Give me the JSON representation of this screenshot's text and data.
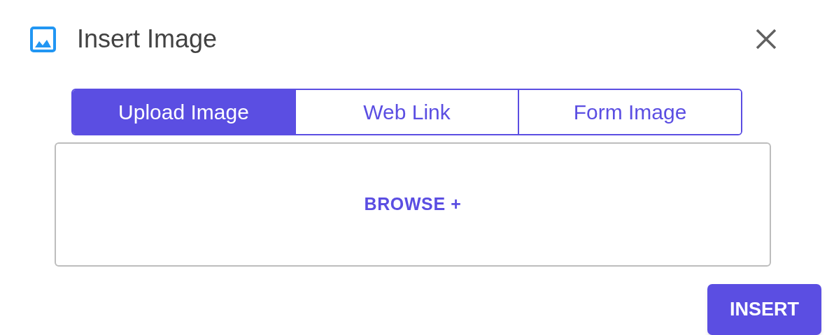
{
  "dialog": {
    "title": "Insert Image"
  },
  "tabs": [
    {
      "label": "Upload Image",
      "selected": true
    },
    {
      "label": "Web Link",
      "selected": false
    },
    {
      "label": "Form Image",
      "selected": false
    }
  ],
  "dropzone": {
    "action": "BROWSE +"
  },
  "buttons": [
    "INSERT"
  ]
}
